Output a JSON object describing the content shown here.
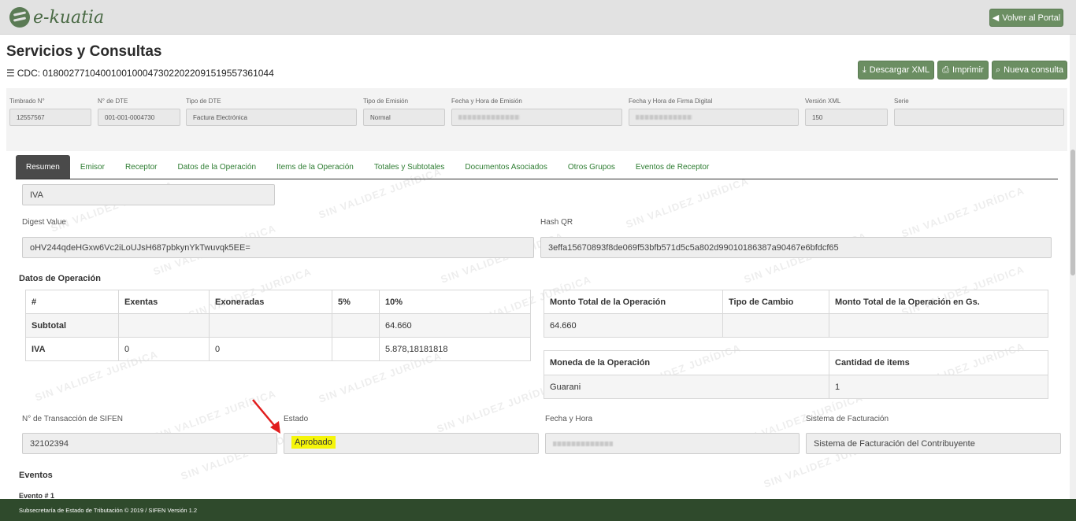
{
  "brand": {
    "name": "e-kuatia"
  },
  "topbar": {
    "back_label": "Volver al Portal"
  },
  "page": {
    "title": "Servicios y Consultas",
    "cdc_label": "CDC:",
    "cdc_value": "01800277104001001000473022022091519557361044"
  },
  "actions": {
    "download_xml": "Descargar XML",
    "print": "Imprimir",
    "new_query": "Nueva consulta"
  },
  "header": {
    "timbrado_label": "Timbrado N°",
    "timbrado_value": "12557567",
    "dte_label": "N° de DTE",
    "dte_value": "001-001-0004730",
    "tipo_dte_label": "Tipo de DTE",
    "tipo_dte_value": "Factura Electrónica",
    "tipo_emision_label": "Tipo de Emisión",
    "tipo_emision_value": "Normal",
    "fecha_emision_label": "Fecha y Hora de Emisión",
    "fecha_firma_label": "Fecha y Hora de Firma Digital",
    "version_label": "Versión XML",
    "version_value": "150",
    "serie_label": "Serie",
    "serie_value": ""
  },
  "tabs": [
    "Resumen",
    "Emisor",
    "Receptor",
    "Datos de la Operación",
    "Items de la Operación",
    "Totales y Subtotales",
    "Documentos Asociados",
    "Otros Grupos",
    "Eventos de Receptor"
  ],
  "summary": {
    "iva_value": "IVA",
    "digest_label": "Digest Value",
    "digest_value": "oHV244qdeHGxw6Vc2iLoUJsH687pbkynYkTwuvqk5EE=",
    "hashqr_label": "Hash QR",
    "hashqr_value": "3effa15670893f8de069f53bfb571d5c5a802d99010186387a90467e6bfdcf65"
  },
  "operacion": {
    "title": "Datos de Operación",
    "headers": [
      "#",
      "Exentas",
      "Exoneradas",
      "5%",
      "10%"
    ],
    "rows": [
      [
        "Subtotal",
        "",
        "",
        "",
        "64.660"
      ],
      [
        "IVA",
        "0",
        "0",
        "",
        "5.878,18181818"
      ]
    ],
    "monto_headers": [
      "Monto Total de la Operación",
      "Tipo de Cambio",
      "Monto Total de la Operación en Gs."
    ],
    "monto_row": [
      "64.660",
      "",
      ""
    ],
    "moneda_headers": [
      "Moneda de la Operación",
      "Cantidad de items"
    ],
    "moneda_row": [
      "Guarani",
      "1"
    ]
  },
  "transaccion": {
    "nro_label": "N° de Transacción de SIFEN",
    "nro_value": "32102394",
    "estado_label": "Estado",
    "estado_value": "Aprobado",
    "fecha_label": "Fecha y Hora",
    "sistema_label": "Sistema de Facturación",
    "sistema_value": "Sistema de Facturación del Contribuyente"
  },
  "eventos": {
    "title": "Eventos",
    "first": "Evento # 1"
  },
  "watermark": "SIN VALIDEZ JURÍDICA",
  "footer": {
    "text": "Subsecretaría de Estado de Tributación © 2019 / SIFEN Versión 1.2"
  },
  "colors": {
    "accent": "#6b8e62",
    "footer": "#2f4a2c",
    "highlight": "#f5f50a",
    "arrow": "#e11d1d"
  }
}
